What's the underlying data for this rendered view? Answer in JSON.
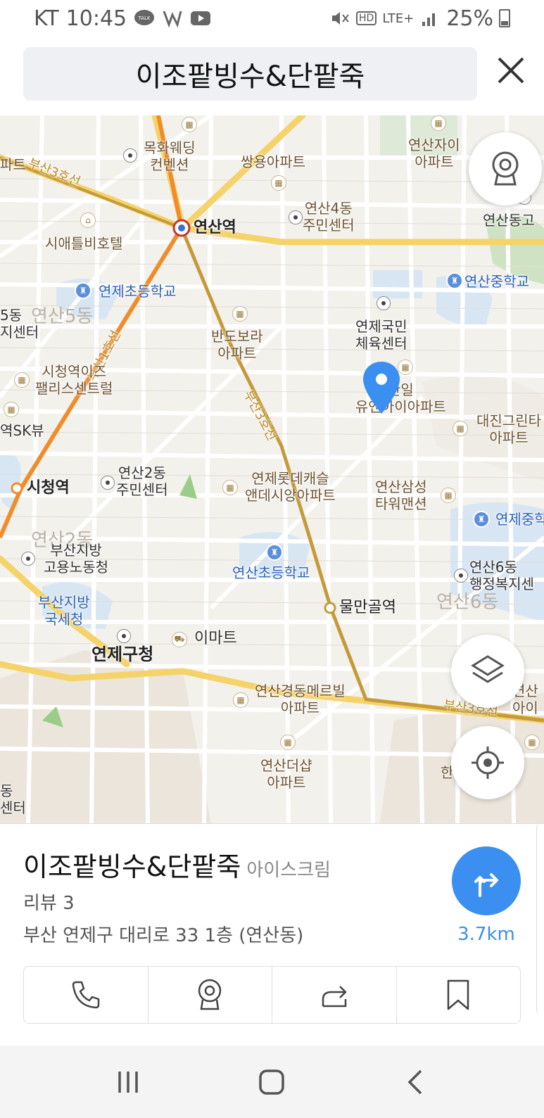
{
  "status_bar": {
    "carrier": "KT",
    "time": "10:45",
    "talk_badge": "TALK",
    "network": "LTE+",
    "hd_badge": "HD",
    "battery": "25%"
  },
  "search": {
    "query": "이조팥빙수&단팥죽"
  },
  "map": {
    "labels": {
      "mokhwa": "목화웨딩\n컨벤션",
      "ssangyong": "쌍용아파트",
      "yeonsanja": "연산자이\n아파트",
      "yeonsan4": "연산4동\n주민센터",
      "yeonsan_station": "연산역",
      "seattle": "시애틀비호텔",
      "yeonsandong_go": "연산동고",
      "yeonje_elem": "연제초등학교",
      "yeonsan_middle": "연산중학교",
      "yeonsan5_gray": "연산5동",
      "dong5": "5동\n지센터",
      "bando": "반도보라\n아파트",
      "yeonje_gukmin": "연제국민\n체육센터",
      "sicheong_eaz": "시청역이즈\n팰리스센트럴",
      "sk": "역SK뷰",
      "hanil": "한일\n유엔아이아파트",
      "daejin": "대진그린타\n아파트",
      "yeonsan2": "연산2동\n주민센터",
      "sicheong_station": "시청역",
      "lotte": "연제롯데캐슬\n앤데시앙아파트",
      "samsung": "연산삼성\n타워맨션",
      "yeonje_mid": "연제중학",
      "busan_labor": "부산지방\n고용노동청",
      "yeonsan_elem": "연산초등학교",
      "yeonsan6": "연산6동\n행정복지센",
      "yeonsan6_gray": "연산6동",
      "mulman": "물만골역",
      "busan_tax": "부산지방\n국세청",
      "emart": "이마트",
      "yeonje_gu": "연제구청",
      "gyeongdong": "연산경동메르빌\n아파트",
      "yeonsan_right": "연산\n아이",
      "deoksap": "연산더샵\n아파트",
      "han": "한",
      "dong_bottom": "동\n센터",
      "line3_a": "부산3호선",
      "line3_b": "부산3호선",
      "line3_c": "부산3호선",
      "line1": "부산1호선",
      "pate": "파트",
      "yeonsan2_gray": "연산2동"
    }
  },
  "place": {
    "name": "이조팥빙수&단팥죽",
    "category": "아이스크림",
    "review": "리뷰 3",
    "address": "부산 연제구 대리로 33 1층 (연산동)",
    "distance": "3.7km"
  },
  "colors": {
    "accent": "#3b8ff0",
    "map_bg": "#f3f1ec",
    "road_main": "#f5d36a",
    "subway_line": "#c49a3a"
  }
}
